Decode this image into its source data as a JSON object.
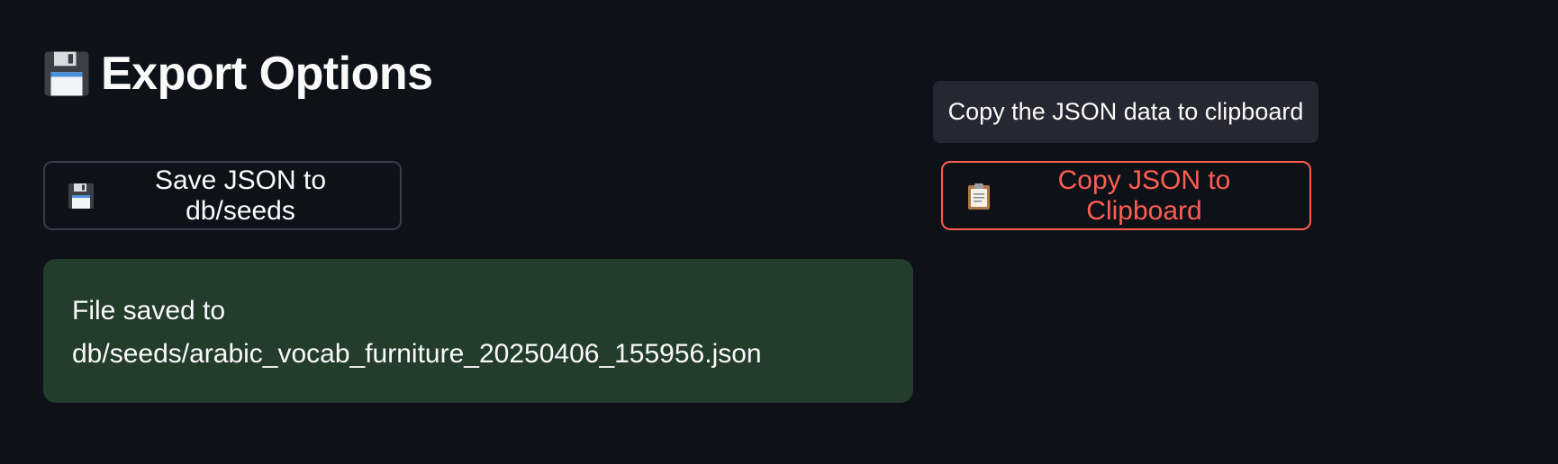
{
  "section": {
    "icon": "floppy-disk-icon",
    "title": "Export Options"
  },
  "buttons": {
    "save": {
      "icon": "floppy-disk-icon",
      "label": "Save JSON to db/seeds"
    },
    "copy": {
      "icon": "clipboard-icon",
      "label": "Copy JSON to Clipboard"
    }
  },
  "tooltip": {
    "text": "Copy the JSON data to clipboard"
  },
  "alert": {
    "type": "success",
    "line1": "File saved to",
    "line2": "db/seeds/arabic_vocab_furniture_20250406_155956.json"
  },
  "colors": {
    "background": "#0e1117",
    "accent": "#ff5d52",
    "success_bg": "#233c2c",
    "tooltip_bg": "#262730"
  }
}
